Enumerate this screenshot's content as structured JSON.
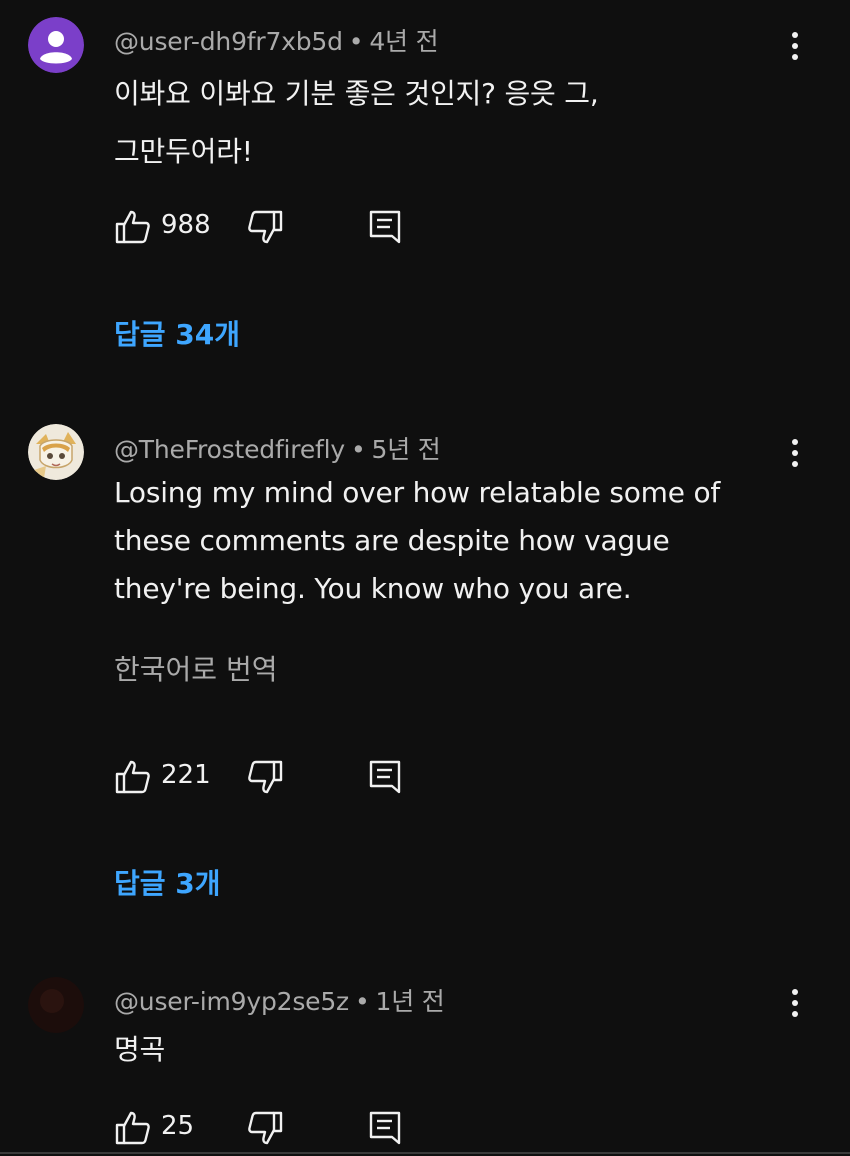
{
  "comments": [
    {
      "handle": "@user-dh9fr7xb5d",
      "time": "4년 전",
      "lines": [
        "이봐요 이봐요 기분 좋은 것인지? 응읏 그,",
        "그만두어라!"
      ],
      "likes": "988",
      "replies": "답글 34개",
      "avatar": "purple-default-avatar",
      "accent": "#7b3fc9"
    },
    {
      "handle": "@TheFrostedfirefly",
      "time": "5년 전",
      "lines": [
        "Losing my mind over how relatable some of",
        "these comments are despite how vague",
        "they're being. You know who you are."
      ],
      "translate": "한국어로 번역",
      "likes": "221",
      "replies": "답글 3개",
      "avatar": "anime-character-avatar"
    },
    {
      "handle": "@user-im9yp2se5z",
      "time": "1년 전",
      "lines": [
        "명곡"
      ],
      "likes": "25",
      "avatar": "dark-red-avatar"
    }
  ],
  "separator": "•",
  "colors": {
    "background": "#0f0f0f",
    "text": "#f1f1f1",
    "secondary": "#aaaaaa",
    "link": "#3ea6ff"
  }
}
